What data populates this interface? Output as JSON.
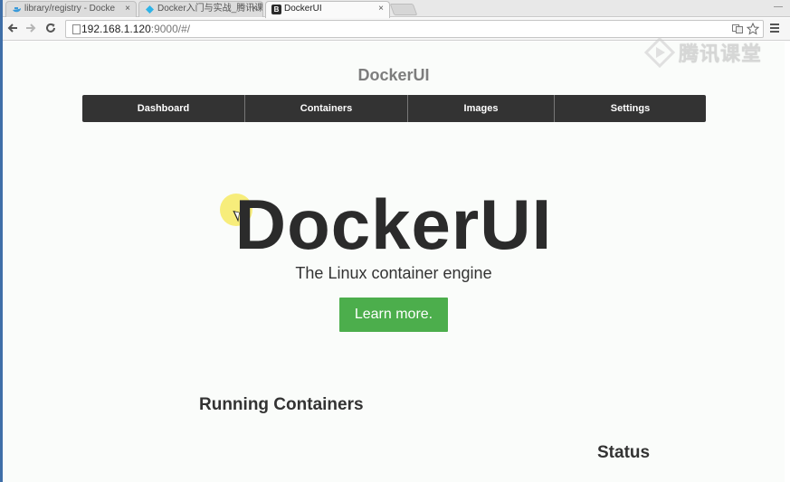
{
  "browser": {
    "tabs": [
      {
        "title": "library/registry - Docke",
        "favicon": "docker-whale-icon",
        "favicon_color": "#3a9ad9",
        "active": false
      },
      {
        "title": "Docker入门与实战_腾讯课",
        "favicon": "tencent-class-icon",
        "favicon_color": "#2db3e8",
        "active": false
      },
      {
        "title": "DockerUI",
        "favicon": "bootstrap-b-icon",
        "favicon_color": "#2a2a2a",
        "favicon_glyph": "B",
        "active": true
      }
    ],
    "tab_close_glyph": "×",
    "url_host": "192.168.1.120",
    "url_rest": ":9000/#/"
  },
  "watermark": {
    "text": "腾讯课堂"
  },
  "page": {
    "brand": "DockerUI",
    "nav": {
      "dashboard": "Dashboard",
      "containers": "Containers",
      "images": "Images",
      "settings": "Settings"
    },
    "hero": {
      "title": "DockerUI",
      "subtitle": "The Linux container engine",
      "button": "Learn more."
    },
    "sections": {
      "running_containers": "Running Containers",
      "status": "Status"
    }
  },
  "colors": {
    "navbar": "#333333",
    "button_green": "#4cae4c",
    "brand_gray": "#7d7d7d",
    "cursor_highlight": "#f5e850"
  }
}
